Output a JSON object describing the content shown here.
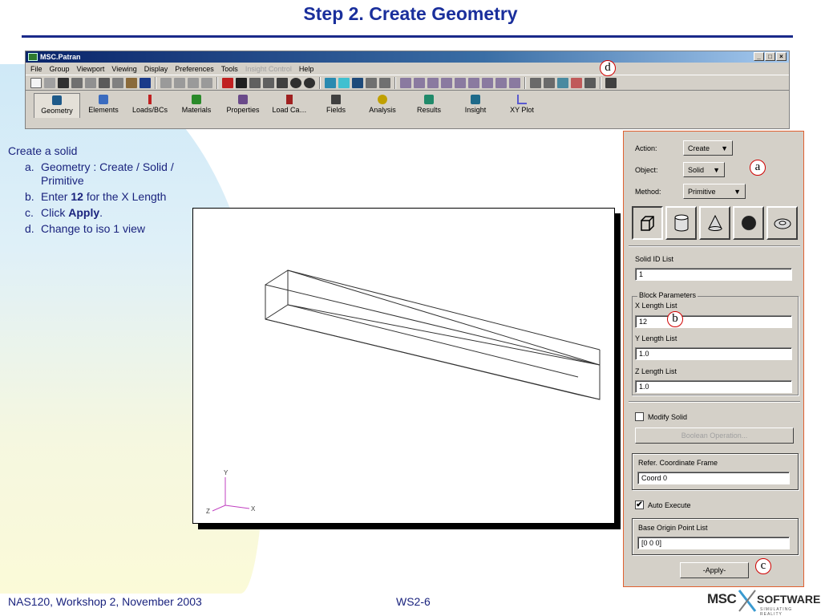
{
  "slide": {
    "title": "Step 2. Create Geometry",
    "footer_left": "NAS120, Workshop 2, November 2003",
    "footer_mid": "WS2-6",
    "logo_msc": "MSC",
    "logo_software": "SOFTWARE",
    "logo_tagline": "SIMULATING REALITY"
  },
  "instructions": {
    "heading": "Create a solid",
    "steps": [
      {
        "letter": "a.",
        "text": "Geometry : Create / Solid / Primitive"
      },
      {
        "letter": "b.",
        "pre": "Enter ",
        "bold": "12",
        "post": " for the X Length"
      },
      {
        "letter": "c.",
        "pre": "Click ",
        "bold": "Apply",
        "post": "."
      },
      {
        "letter": "d.",
        "text": "Change to iso 1 view"
      }
    ]
  },
  "window": {
    "title": "MSC.Patran",
    "controls": [
      "_",
      "□",
      "×"
    ],
    "menu": [
      {
        "label": "File",
        "enabled": true
      },
      {
        "label": "Group",
        "enabled": true
      },
      {
        "label": "Viewport",
        "enabled": true
      },
      {
        "label": "Viewing",
        "enabled": true
      },
      {
        "label": "Display",
        "enabled": true
      },
      {
        "label": "Preferences",
        "enabled": true
      },
      {
        "label": "Tools",
        "enabled": true
      },
      {
        "label": "Insight Control",
        "enabled": false
      },
      {
        "label": "Help",
        "enabled": true
      }
    ],
    "tabs": [
      {
        "label": "Geometry",
        "icon": "geometry-icon",
        "color": "#1e5a8a",
        "active": true
      },
      {
        "label": "Elements",
        "icon": "elements-icon",
        "color": "#3a6bbf",
        "active": false
      },
      {
        "label": "Loads/BCs",
        "icon": "loads-icon",
        "color": "#c02020",
        "active": false
      },
      {
        "label": "Materials",
        "icon": "materials-icon",
        "color": "#2a8a2a",
        "active": false
      },
      {
        "label": "Properties",
        "icon": "properties-icon",
        "color": "#6a4a8a",
        "active": false
      },
      {
        "label": "Load Ca…",
        "icon": "load-cases-icon",
        "color": "#a02020",
        "active": false
      },
      {
        "label": "Fields",
        "icon": "fields-icon",
        "color": "#404040",
        "active": false
      },
      {
        "label": "Analysis",
        "icon": "analysis-icon",
        "color": "#c0a000",
        "active": false
      },
      {
        "label": "Results",
        "icon": "results-icon",
        "color": "#208a6a",
        "active": false
      },
      {
        "label": "Insight",
        "icon": "insight-icon",
        "color": "#1e6a8a",
        "active": false
      },
      {
        "label": "XY Plot",
        "icon": "xy-plot-icon",
        "color": "#5a5ad0",
        "active": false
      }
    ]
  },
  "viewport": {
    "axis_x": "X",
    "axis_y": "Y",
    "axis_z": "Z"
  },
  "form": {
    "action_label": "Action:",
    "action_value": "Create",
    "object_label": "Object:",
    "object_value": "Solid",
    "method_label": "Method:",
    "method_value": "Primitive",
    "solid_id_label": "Solid ID List",
    "solid_id_value": "1",
    "block_params_label": "Block Parameters",
    "x_length_label": "X Length List",
    "x_length_value": "12",
    "y_length_label": "Y Length List",
    "y_length_value": "1.0",
    "z_length_label": "Z Length List",
    "z_length_value": "1.0",
    "modify_solid_label": "Modify Solid",
    "boolean_op_label": "Boolean Operation...",
    "ref_frame_label": "Refer. Coordinate Frame",
    "ref_frame_value": "Coord 0",
    "auto_execute_label": "Auto Execute",
    "auto_execute_checked": "✔",
    "base_origin_label": "Base Origin Point List",
    "base_origin_value": "[0 0 0]",
    "apply_label": "-Apply-"
  },
  "callouts": {
    "a": "a",
    "b": "b",
    "c": "c",
    "d": "d"
  },
  "colors": {
    "title_blue": "#1a2f9c",
    "text_blue": "#1a237e",
    "panel_border": "#e06030",
    "callout_red": "#d00000"
  }
}
